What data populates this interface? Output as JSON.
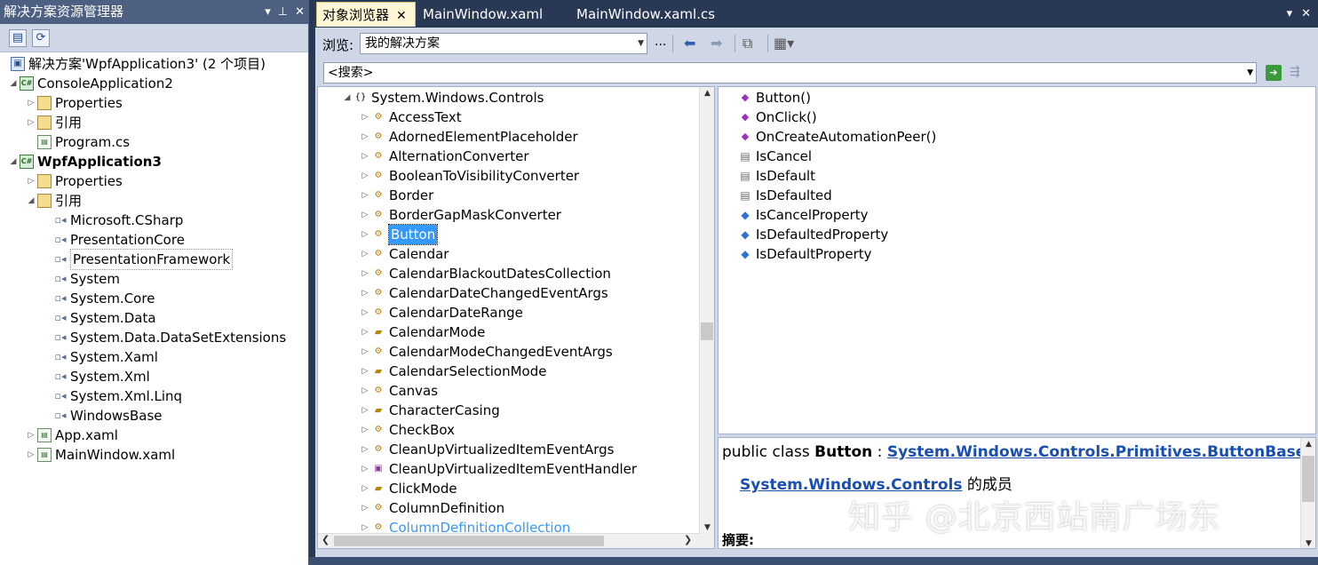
{
  "solution_explorer": {
    "title": "解决方案资源管理器",
    "title_buttons": [
      "▾",
      "⊥",
      "✕"
    ],
    "toolbar": [
      "properties-icon",
      "refresh-icon"
    ],
    "tree": [
      {
        "label": "解决方案'WpfApplication3' (2 个项目)",
        "indent": 0,
        "icon": "sol",
        "arrow": ""
      },
      {
        "label": "ConsoleApplication2",
        "indent": 1,
        "icon": "proj",
        "arrow": "◢"
      },
      {
        "label": "Properties",
        "indent": 2,
        "icon": "folder",
        "arrow": "▷"
      },
      {
        "label": "引用",
        "indent": 2,
        "icon": "folder",
        "arrow": "▷"
      },
      {
        "label": "Program.cs",
        "indent": 2,
        "icon": "file",
        "arrow": ""
      },
      {
        "label": "WpfApplication3",
        "indent": 1,
        "icon": "proj",
        "arrow": "◢",
        "bold": true
      },
      {
        "label": "Properties",
        "indent": 2,
        "icon": "folder",
        "arrow": "▷"
      },
      {
        "label": "引用",
        "indent": 2,
        "icon": "folder",
        "arrow": "◢"
      },
      {
        "label": "Microsoft.CSharp",
        "indent": 3,
        "icon": "ref",
        "arrow": ""
      },
      {
        "label": "PresentationCore",
        "indent": 3,
        "icon": "ref",
        "arrow": ""
      },
      {
        "label": "PresentationFramework",
        "indent": 3,
        "icon": "ref",
        "arrow": "",
        "boxed": true
      },
      {
        "label": "System",
        "indent": 3,
        "icon": "ref",
        "arrow": ""
      },
      {
        "label": "System.Core",
        "indent": 3,
        "icon": "ref",
        "arrow": ""
      },
      {
        "label": "System.Data",
        "indent": 3,
        "icon": "ref",
        "arrow": ""
      },
      {
        "label": "System.Data.DataSetExtensions",
        "indent": 3,
        "icon": "ref",
        "arrow": ""
      },
      {
        "label": "System.Xaml",
        "indent": 3,
        "icon": "ref",
        "arrow": ""
      },
      {
        "label": "System.Xml",
        "indent": 3,
        "icon": "ref",
        "arrow": ""
      },
      {
        "label": "System.Xml.Linq",
        "indent": 3,
        "icon": "ref",
        "arrow": ""
      },
      {
        "label": "WindowsBase",
        "indent": 3,
        "icon": "ref",
        "arrow": ""
      },
      {
        "label": "App.xaml",
        "indent": 2,
        "icon": "file",
        "arrow": "▷"
      },
      {
        "label": "MainWindow.xaml",
        "indent": 2,
        "icon": "file",
        "arrow": "▷"
      }
    ]
  },
  "tabs": [
    {
      "label": "对象浏览器",
      "active": true,
      "close": "✕"
    },
    {
      "label": "MainWindow.xaml",
      "active": false
    },
    {
      "label": "MainWindow.xaml.cs",
      "active": false
    }
  ],
  "tabs_controls": [
    "▾",
    "✕"
  ],
  "object_browser": {
    "browse_label": "浏览:",
    "browse_value": "我的解决方案",
    "browse_more": "...",
    "search_value": "<搜索>",
    "namespace": "System.Windows.Controls",
    "types": [
      {
        "label": "AccessText",
        "kind": "cls"
      },
      {
        "label": "AdornedElementPlaceholder",
        "kind": "cls"
      },
      {
        "label": "AlternationConverter",
        "kind": "cls"
      },
      {
        "label": "BooleanToVisibilityConverter",
        "kind": "cls"
      },
      {
        "label": "Border",
        "kind": "cls"
      },
      {
        "label": "BorderGapMaskConverter",
        "kind": "cls"
      },
      {
        "label": "Button",
        "kind": "cls",
        "selected": true
      },
      {
        "label": "Calendar",
        "kind": "cls"
      },
      {
        "label": "CalendarBlackoutDatesCollection",
        "kind": "cls"
      },
      {
        "label": "CalendarDateChangedEventArgs",
        "kind": "cls"
      },
      {
        "label": "CalendarDateRange",
        "kind": "cls"
      },
      {
        "label": "CalendarMode",
        "kind": "enum"
      },
      {
        "label": "CalendarModeChangedEventArgs",
        "kind": "cls"
      },
      {
        "label": "CalendarSelectionMode",
        "kind": "enum"
      },
      {
        "label": "Canvas",
        "kind": "cls"
      },
      {
        "label": "CharacterCasing",
        "kind": "enum"
      },
      {
        "label": "CheckBox",
        "kind": "cls"
      },
      {
        "label": "CleanUpVirtualizedItemEventArgs",
        "kind": "cls"
      },
      {
        "label": "CleanUpVirtualizedItemEventHandler",
        "kind": "del"
      },
      {
        "label": "ClickMode",
        "kind": "enum"
      },
      {
        "label": "ColumnDefinition",
        "kind": "cls"
      },
      {
        "label": "ColumnDefinitionCollection",
        "kind": "cls"
      }
    ],
    "members": [
      {
        "label": "Button()",
        "kind": "method"
      },
      {
        "label": "OnClick()",
        "kind": "method"
      },
      {
        "label": "OnCreateAutomationPeer()",
        "kind": "method"
      },
      {
        "label": "IsCancel",
        "kind": "prop"
      },
      {
        "label": "IsDefault",
        "kind": "prop"
      },
      {
        "label": "IsDefaulted",
        "kind": "prop"
      },
      {
        "label": "IsCancelProperty",
        "kind": "field"
      },
      {
        "label": "IsDefaultedProperty",
        "kind": "field"
      },
      {
        "label": "IsDefaultProperty",
        "kind": "field"
      }
    ],
    "description": {
      "prefix": "public class ",
      "class_name": "Button",
      "colon": " : ",
      "base_link": "System.Windows.Controls.Primitives.ButtonBase",
      "namespace_link": "System.Windows.Controls",
      "member_of": " 的成员",
      "summary": "摘要:"
    }
  },
  "watermark": "知乎 @北京西站南广场东"
}
